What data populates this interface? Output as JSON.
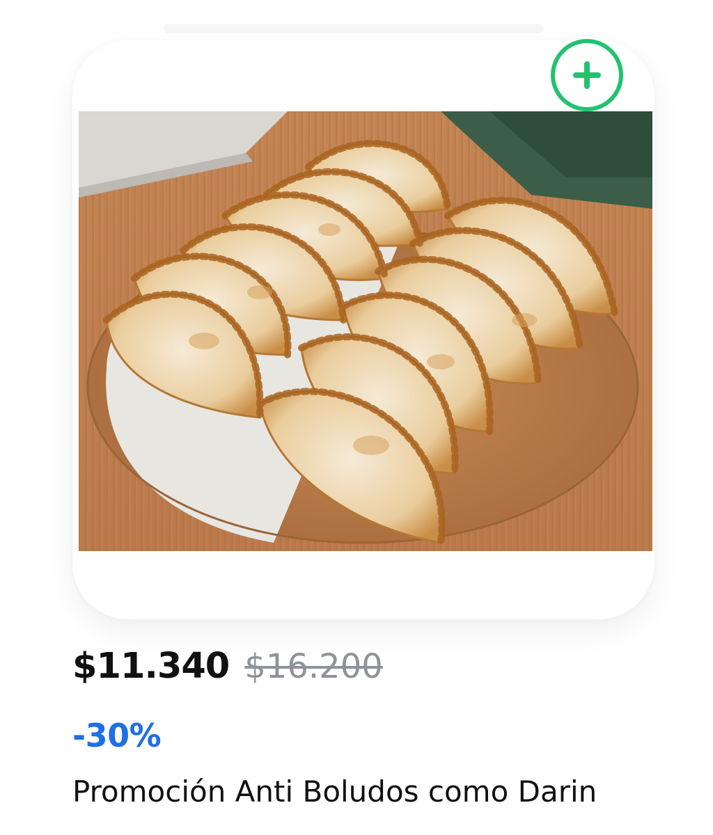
{
  "product": {
    "price": "$11.340",
    "original_price": "$16.200",
    "discount": "-30%",
    "name": "Promoción Anti Boludos como Darin",
    "image_alt": "Empanadas en tabla de madera"
  },
  "add_button": {
    "icon": "plus-icon",
    "accent_color": "#22c26f"
  },
  "colors": {
    "price": "#111111",
    "original_price": "#8e939a",
    "discount": "#1f6fe6"
  }
}
